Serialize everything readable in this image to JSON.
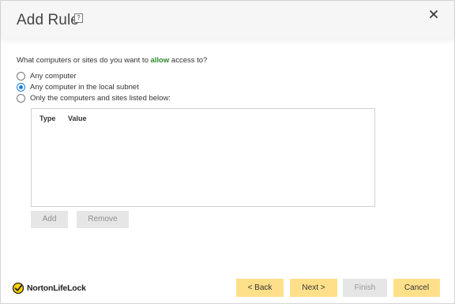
{
  "dialog": {
    "title": "Add Rule",
    "help_glyph": "?",
    "close_glyph": "✕"
  },
  "question": {
    "prefix": "What computers or sites do you want to ",
    "emphasis": "allow",
    "suffix": " access to?",
    "emphasis_color": "#2e8b2e"
  },
  "options": [
    {
      "label": "Any computer",
      "checked": false
    },
    {
      "label": "Any computer in the local subnet",
      "checked": true
    },
    {
      "label": "Only the computers and sites listed below:",
      "checked": false
    }
  ],
  "table": {
    "columns": [
      "Type",
      "Value"
    ],
    "rows": []
  },
  "list_buttons": {
    "add": "Add",
    "remove": "Remove"
  },
  "footer": {
    "logo_text": "NortonLifeLock",
    "back": "< Back",
    "next": "Next >",
    "finish": "Finish",
    "cancel": "Cancel",
    "accent_color": "#ffe08a"
  }
}
